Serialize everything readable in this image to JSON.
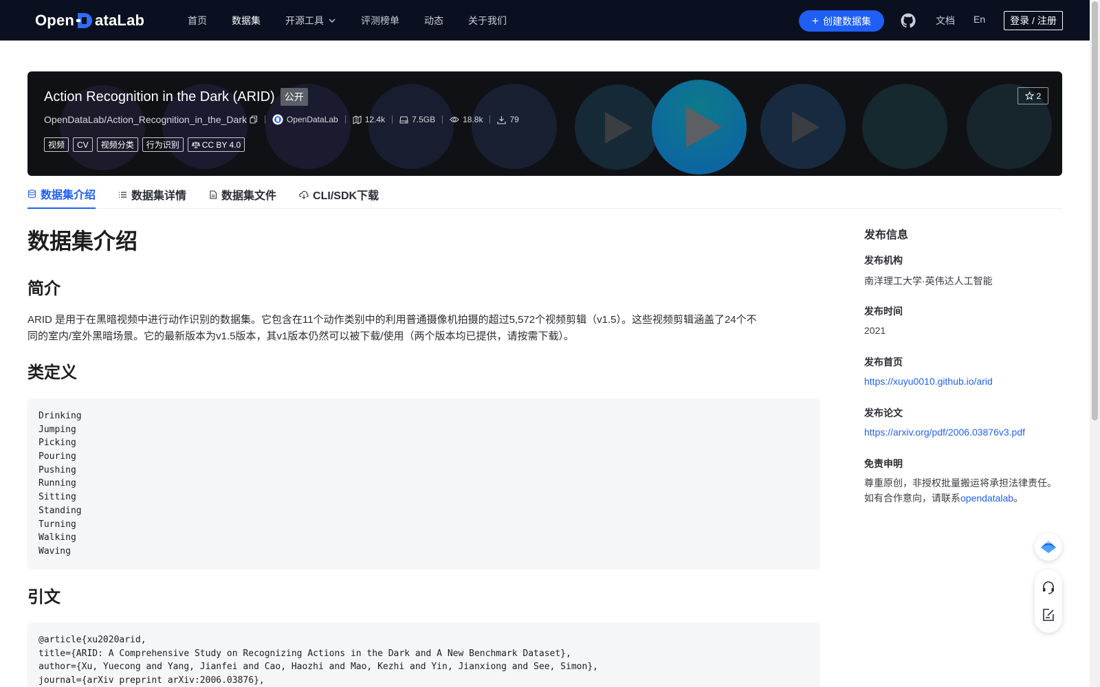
{
  "nav": {
    "logo_text_left": "Open",
    "logo_text_right": "ataLab",
    "links": [
      "首页",
      "数据集",
      "开源工具",
      "评测榜单",
      "动态",
      "关于我们"
    ],
    "active_link": "数据集",
    "create_label": "创建数据集",
    "docs_label": "文档",
    "lang_label": "En",
    "login_label": "登录 / 注册"
  },
  "banner": {
    "title": "Action Recognition in the Dark (ARID)",
    "visibility": "公开",
    "repo_path": "OpenDataLab/Action_Recognition_in_the_Dark",
    "publisher": "OpenDataLab",
    "files_count": "12.4k",
    "size": "7.5GB",
    "views": "18.8k",
    "downloads": "79",
    "tags": [
      "视频",
      "CV",
      "视频分类",
      "行为识别"
    ],
    "license": "CC BY 4.0",
    "stars": "2"
  },
  "tabs": {
    "intro": "数据集介绍",
    "details": "数据集详情",
    "files": "数据集文件",
    "download": "CLI/SDK下载"
  },
  "content": {
    "heading": "数据集介绍",
    "summary_heading": "简介",
    "summary_line1": "ARID 是用于在黑暗视频中进行动作识别的数据集。它包含在11个动作类别中的利用普通摄像机拍摄的超过5,572个视频剪辑（v1.5）。这些视频剪辑涵盖了24个不",
    "summary_line2": "同的室内/室外黑暗场景。它的最新版本为v1.5版本，其v1版本仍然可以被下载/使用（两个版本均已提供，请按需下载）。",
    "classes_heading": "类定义",
    "classes": [
      "Drinking",
      "Jumping",
      "Picking",
      "Pouring",
      "Pushing",
      "Running",
      "Sitting",
      "Standing",
      "Turning",
      "Walking",
      "Waving"
    ],
    "citation_heading": "引文",
    "citation_lines": [
      "@article{xu2020arid,",
      "title={ARID: A Comprehensive Study on Recognizing Actions in the Dark and A New Benchmark Dataset},",
      "author={Xu, Yuecong and Yang, Jianfei and Cao, Haozhi and Mao, Kezhi and Yin, Jianxiong and See, Simon},",
      "journal={arXiv preprint arXiv:2006.03876},"
    ]
  },
  "sidebar": {
    "title": "发布信息",
    "org_label": "发布机构",
    "org_value": "南洋理工大学·英伟达人工智能",
    "time_label": "发布时间",
    "time_value": "2021",
    "home_label": "发布首页",
    "home_url": "https://xuyu0010.github.io/arid",
    "paper_label": "发布论文",
    "paper_url": "https://arxiv.org/pdf/2006.03876v3.pdf",
    "disclaimer_label": "免责申明",
    "disclaimer_line1": "尊重原创，非授权批量搬运将承担法律责任。",
    "disclaimer_line2_prefix": "如有合作意向，请联系",
    "disclaimer_link": "opendatalab",
    "disclaimer_suffix": "。"
  },
  "colors": {
    "nav_bg": "#0a1020",
    "accent": "#1f5ff5",
    "banner_bg": "#101114",
    "code_bg": "#f5f6f7"
  }
}
